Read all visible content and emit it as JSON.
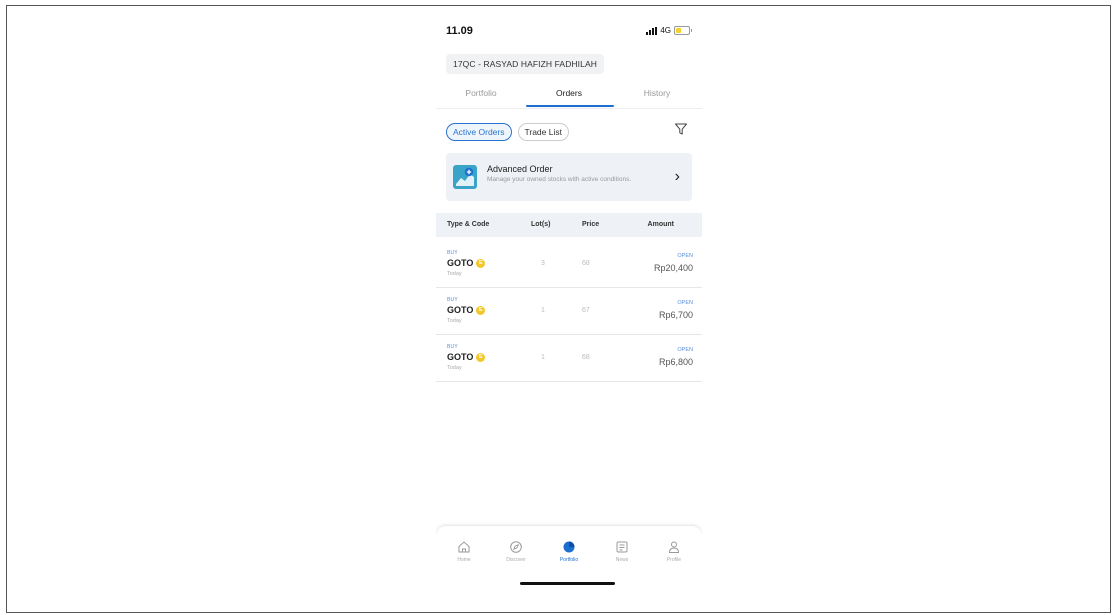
{
  "status_bar": {
    "time": "11.09",
    "network": "4G"
  },
  "account": {
    "label": "17QC - RASYAD HAFIZH FADHILAH"
  },
  "tabs": [
    {
      "label": "Portfolio",
      "active": false
    },
    {
      "label": "Orders",
      "active": true
    },
    {
      "label": "History",
      "active": false
    }
  ],
  "filters": {
    "active_orders": "Active Orders",
    "trade_list": "Trade List"
  },
  "advanced_order": {
    "title": "Advanced Order",
    "description": "Manage your owned stocks with active conditions."
  },
  "table": {
    "headers": {
      "type_code": "Type & Code",
      "lots": "Lot(s)",
      "price": "Price",
      "amount": "Amount"
    },
    "rows": [
      {
        "type": "BUY",
        "code": "GOTO",
        "badge": "E",
        "date": "Today",
        "lots": "3",
        "price": "68",
        "status": "OPEN",
        "amount": "Rp20,400"
      },
      {
        "type": "BUY",
        "code": "GOTO",
        "badge": "E",
        "date": "Today",
        "lots": "1",
        "price": "67",
        "status": "OPEN",
        "amount": "Rp6,700"
      },
      {
        "type": "BUY",
        "code": "GOTO",
        "badge": "E",
        "date": "Today",
        "lots": "1",
        "price": "68",
        "status": "OPEN",
        "amount": "Rp6,800"
      }
    ]
  },
  "bottom_nav": [
    {
      "label": "Home",
      "icon": "home-icon",
      "active": false
    },
    {
      "label": "Discover",
      "icon": "compass-icon",
      "active": false
    },
    {
      "label": "Portfolio",
      "icon": "pie-chart-icon",
      "active": true
    },
    {
      "label": "News",
      "icon": "news-icon",
      "active": false
    },
    {
      "label": "Profile",
      "icon": "profile-icon",
      "active": false
    }
  ],
  "colors": {
    "accent": "#1b6fd1",
    "badge": "#f3c62a",
    "panel": "#eef2f6"
  }
}
